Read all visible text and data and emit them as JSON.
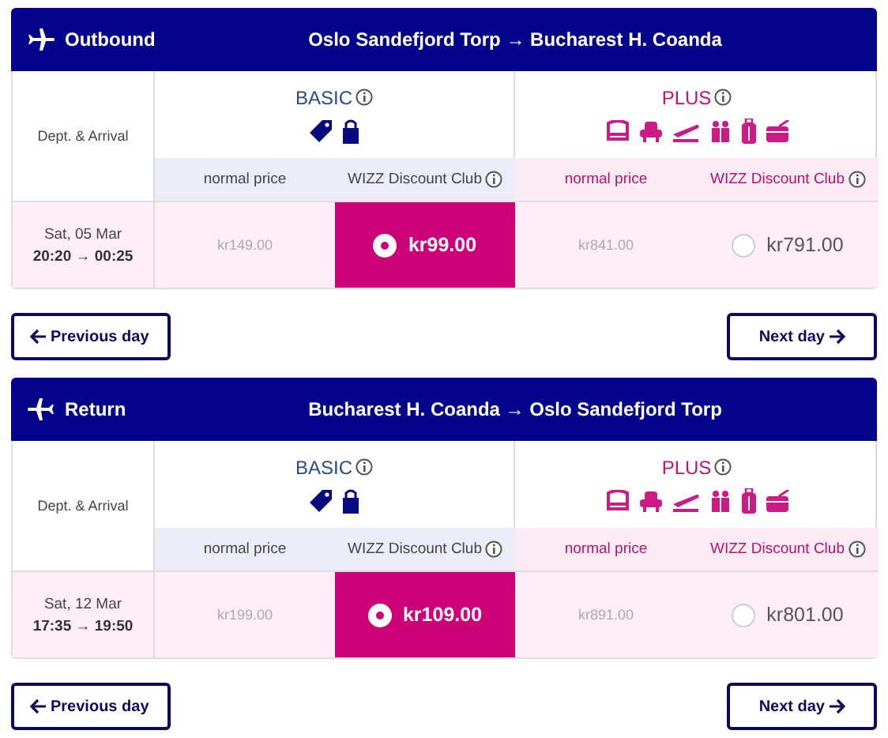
{
  "sections": [
    {
      "kind": "outbound",
      "title": "Outbound",
      "route": "Oslo Sandefjord Torp → Bucharest H. Coanda",
      "dept_label": "Dept. & Arrival",
      "date": "Sat, 05 Mar",
      "times": "20:20 → 00:25",
      "fares": [
        {
          "kind": "basic",
          "name": "BASIC",
          "normal_label": "normal price",
          "club_label": "WIZZ Discount Club",
          "normal_price": "kr149.00",
          "club_price": "kr99.00",
          "selected": true
        },
        {
          "kind": "plus",
          "name": "PLUS",
          "normal_label": "normal price",
          "club_label": "WIZZ Discount Club",
          "normal_price": "kr841.00",
          "club_price": "kr791.00",
          "selected": false
        }
      ],
      "prev_button": "Previous day",
      "next_button": "Next day"
    },
    {
      "kind": "return",
      "title": "Return",
      "route": "Bucharest H. Coanda → Oslo Sandefjord Torp",
      "dept_label": "Dept. & Arrival",
      "date": "Sat, 12 Mar",
      "times": "17:35 → 19:50",
      "fares": [
        {
          "kind": "basic",
          "name": "BASIC",
          "normal_label": "normal price",
          "club_label": "WIZZ Discount Club",
          "normal_price": "kr199.00",
          "club_price": "kr109.00",
          "selected": true
        },
        {
          "kind": "plus",
          "name": "PLUS",
          "normal_label": "normal price",
          "club_label": "WIZZ Discount Club",
          "normal_price": "kr891.00",
          "club_price": "kr801.00",
          "selected": false
        }
      ],
      "prev_button": "Previous day",
      "next_button": "Next day"
    }
  ]
}
